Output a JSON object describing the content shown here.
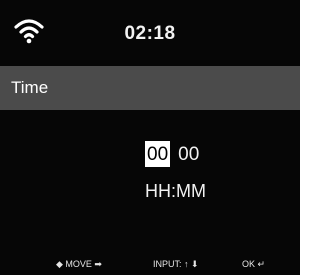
{
  "status_bar": {
    "wifi_icon": "wifi-icon",
    "time": "02:18"
  },
  "title_bar": {
    "title": "Time"
  },
  "editor": {
    "hour": "00",
    "minute": "00",
    "format": "HH:MM"
  },
  "footer": {
    "move_hint": "◆ MOVE ➡",
    "input_hint": "INPUT: ↑ ⬇",
    "ok_hint": "OK ↵"
  },
  "colors": {
    "background": "#060606",
    "title_bar": "#4b4b4b",
    "text": "#f2f2f2",
    "selection": "#ffffff"
  }
}
